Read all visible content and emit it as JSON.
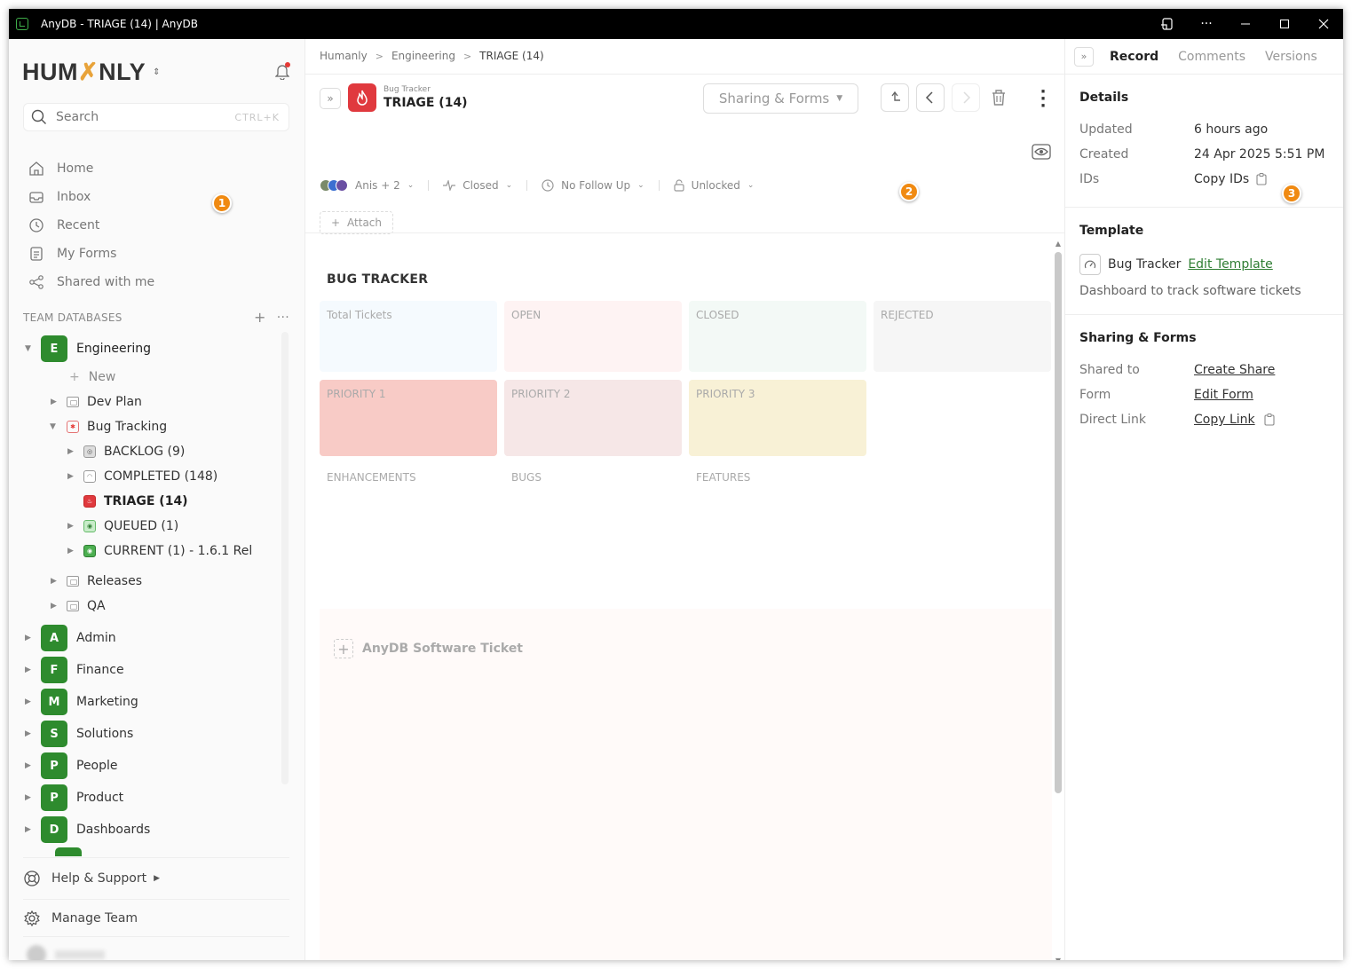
{
  "window": {
    "title": "AnyDB - TRIAGE (14) | AnyDB",
    "controls": [
      "cast-icon",
      "more-icon",
      "minimize-icon",
      "maximize-icon",
      "close-icon"
    ]
  },
  "sidebar": {
    "logo": {
      "part1": "HUM",
      "x": "✗",
      "part2": "NLY"
    },
    "search": {
      "label": "Search",
      "shortcut": "CTRL+K"
    },
    "nav": [
      {
        "label": "Home",
        "icon": "home-icon"
      },
      {
        "label": "Inbox",
        "icon": "inbox-icon"
      },
      {
        "label": "Recent",
        "icon": "clock-icon"
      },
      {
        "label": "My Forms",
        "icon": "form-icon"
      },
      {
        "label": "Shared with me",
        "icon": "share-icon"
      }
    ],
    "team_header": "TEAM DATABASES",
    "tree": {
      "engineering": {
        "badge": "E",
        "label": "Engineering"
      },
      "new_label": "New",
      "dev_plan": "Dev Plan",
      "bug_tracking": "Bug Tracking",
      "backlog": "BACKLOG (9)",
      "completed": "COMPLETED (148)",
      "triage": "TRIAGE (14)",
      "queued": "QUEUED (1)",
      "current": "CURRENT (1) - 1.6.1 Rel",
      "releases": "Releases",
      "qa": "QA"
    },
    "databases": [
      {
        "badge": "A",
        "label": "Admin"
      },
      {
        "badge": "F",
        "label": "Finance"
      },
      {
        "badge": "M",
        "label": "Marketing"
      },
      {
        "badge": "S",
        "label": "Solutions"
      },
      {
        "badge": "P",
        "label": "People"
      },
      {
        "badge": "P",
        "label": "Product"
      },
      {
        "badge": "D",
        "label": "Dashboards"
      }
    ],
    "footer": {
      "help": "Help & Support",
      "manage": "Manage Team"
    }
  },
  "main": {
    "breadcrumb": [
      "Humanly",
      "Engineering",
      "TRIAGE (14)"
    ],
    "record": {
      "parent": "Bug Tracker",
      "title": "TRIAGE (14)"
    },
    "share_button": "Sharing & Forms",
    "props": {
      "assignees": "Anis + 2",
      "status": "Closed",
      "follow_up": "No Follow Up",
      "lock": "Unlocked"
    },
    "attach": "Attach",
    "section_title": "BUG TRACKER",
    "cards": [
      {
        "label": "Total Tickets",
        "color": "#f5fafe"
      },
      {
        "label": "OPEN",
        "color": "#fef3f3"
      },
      {
        "label": "CLOSED",
        "color": "#f3f9f6"
      },
      {
        "label": "REJECTED",
        "color": "#f6f6f6"
      },
      {
        "label": "PRIORITY 1",
        "color": "#f8cbc6"
      },
      {
        "label": "PRIORITY 2",
        "color": "#f6e7e7"
      },
      {
        "label": "PRIORITY 3",
        "color": "#f8f1d6"
      }
    ],
    "labels": [
      "ENHANCEMENTS",
      "BUGS",
      "FEATURES"
    ],
    "ticket_add": "AnyDB Software Ticket"
  },
  "right_panel": {
    "tabs": [
      "Record",
      "Comments",
      "Versions"
    ],
    "details": {
      "title": "Details",
      "updated_label": "Updated",
      "updated_value": "6 hours ago",
      "created_label": "Created",
      "created_value": "24 Apr 2025 5:51 PM",
      "ids_label": "IDs",
      "ids_value": "Copy IDs"
    },
    "template": {
      "title": "Template",
      "name": "Bug Tracker",
      "edit": "Edit Template",
      "description": "Dashboard to track software tickets"
    },
    "sharing": {
      "title": "Sharing & Forms",
      "shared_label": "Shared to",
      "shared_value": "Create Share",
      "form_label": "Form",
      "form_value": "Edit Form",
      "link_label": "Direct Link",
      "link_value": "Copy Link"
    }
  },
  "markers": [
    "1",
    "2",
    "3"
  ]
}
